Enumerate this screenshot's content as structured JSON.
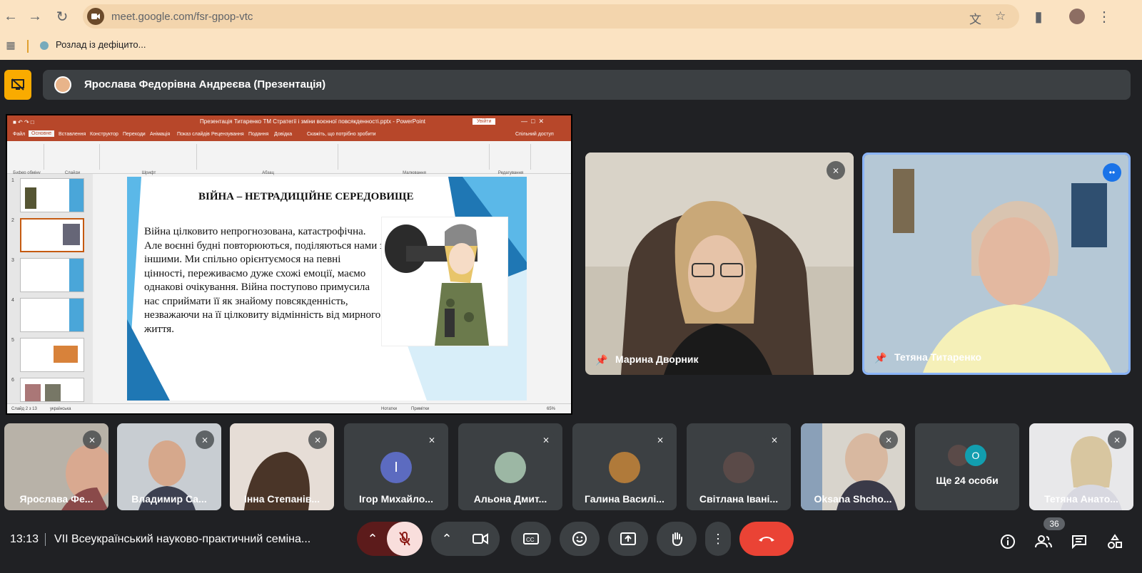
{
  "browser": {
    "url_host": "meet.google.com/",
    "url_path": "fsr-gpop-vtc",
    "bookmark": "Розлад із дефіцито..."
  },
  "banner": {
    "presenter_text": "Ярослава Федорівна Андреєва (Презентація)"
  },
  "powerpoint": {
    "window_title": "Презентація Титаренко ТМ Стратегії і зміни воєнної повсякденності.pptx - PowerPoint",
    "signin": "Увійти",
    "tabs": [
      "Файл",
      "Основне",
      "Вставлення",
      "Конструктор",
      "Переходи",
      "Анімація",
      "Показ слайдів",
      "Рецензування",
      "Подання",
      "Довідка"
    ],
    "tell_me": "Скажіть, що потрібно зробити",
    "share": "Спільний доступ",
    "ribbon_groups": [
      "Буфер обміну",
      "Слайди",
      "Шрифт",
      "Абзац",
      "Малювання",
      "Редагування"
    ],
    "status_left": "Слайд 2 з 13",
    "status_lang": "українська",
    "status_notes": "Нотатки",
    "status_comments": "Примітки",
    "zoom": "65%",
    "thumb_numbers": [
      "1",
      "2",
      "3",
      "4",
      "5",
      "6"
    ]
  },
  "slide": {
    "heading": "ВІЙНА – НЕТРАДИЦІЙНЕ СЕРЕДОВИЩЕ",
    "body": "Війна цілковито непрогнозована, катастрофічна. Але воєнні будні повторюються, поділяються нами з іншими. Ми спільно орієнтуємося на певні цінності, переживаємо дуже схожі емоції, маємо однакові очікування. Війна поступово примусила нас сприймати її як знайому повсякденність, незважаючи на її цілковиту відмінність від мирного життя."
  },
  "featured": [
    {
      "name": "Марина Дворник"
    },
    {
      "name": "Тетяна Титаренко"
    }
  ],
  "participants": [
    {
      "name": "Ярослава Фе...",
      "kind": "video"
    },
    {
      "name": "Владимир Са...",
      "kind": "video"
    },
    {
      "name": "Інна Степанів...",
      "kind": "video"
    },
    {
      "name": "Ігор Михайло...",
      "kind": "letter",
      "letter": "І",
      "color": "#5c6bc0"
    },
    {
      "name": "Альона Дмит...",
      "kind": "photo"
    },
    {
      "name": "Галина Василі...",
      "kind": "photo"
    },
    {
      "name": "Світлана Івані...",
      "kind": "photo"
    },
    {
      "name": "Oksana Shcho...",
      "kind": "video"
    },
    {
      "name": "Ще 24 особи",
      "kind": "more",
      "letter": "O"
    },
    {
      "name": "Тетяна Анато...",
      "kind": "video"
    }
  ],
  "bottom": {
    "time": "13:13",
    "meeting_title": "VII Всеукраїнський науково-практичний семіна...",
    "participant_count": "36"
  }
}
